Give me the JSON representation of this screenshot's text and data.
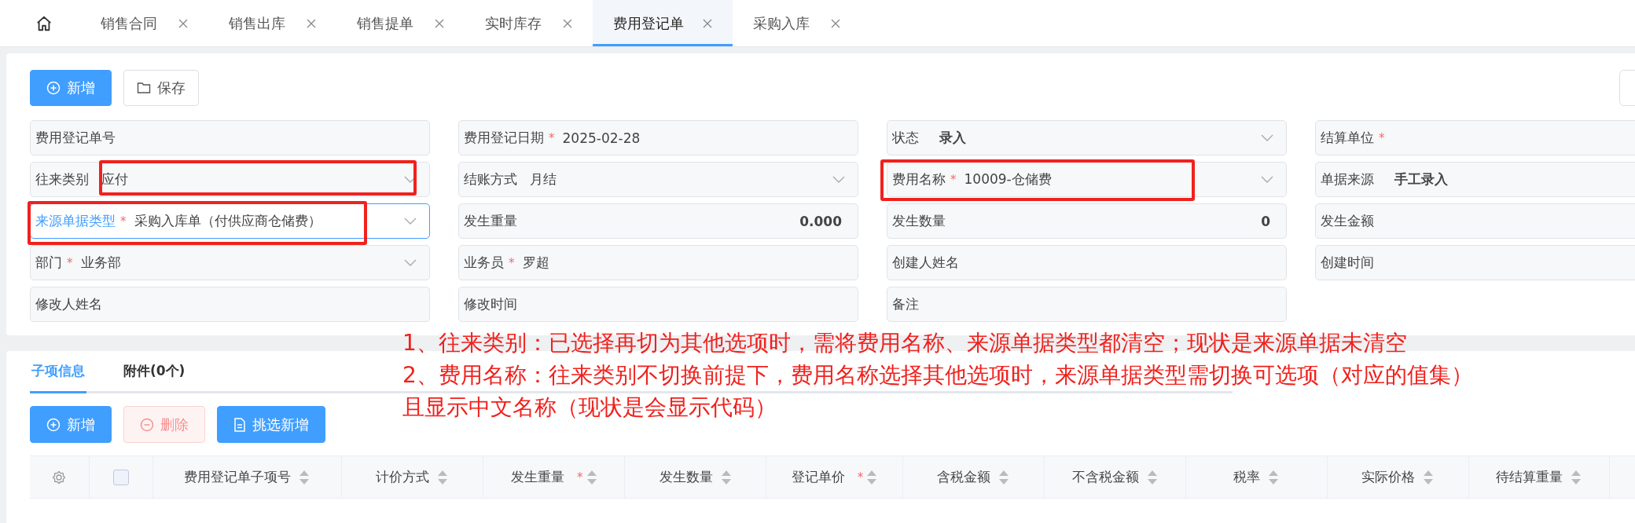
{
  "tabs": [
    {
      "label": "销售合同",
      "selected": false
    },
    {
      "label": "销售出库",
      "selected": false
    },
    {
      "label": "销售提单",
      "selected": false
    },
    {
      "label": "实时库存",
      "selected": false
    },
    {
      "label": "费用登记单",
      "selected": true
    },
    {
      "label": "采购入库",
      "selected": false
    }
  ],
  "toolbar": [
    {
      "label": "新增",
      "kind": "primary"
    },
    {
      "label": "保存",
      "kind": "default"
    }
  ],
  "fields": [
    {
      "label": "费用登记单号",
      "kind": "text",
      "focused": false,
      "highlighted": false
    },
    {
      "label": "费用登记日期",
      "required_mark": "*",
      "kind": "text",
      "value": "2025-02-28",
      "emphasis": false,
      "focused": false,
      "highlighted": false
    },
    {
      "label": "状态",
      "kind": "select",
      "value": "录入",
      "emphasis": true,
      "focused": false,
      "highlighted": false
    },
    {
      "label": "结算单位",
      "required_mark": "*",
      "kind": "text",
      "focused": false,
      "highlighted": false
    },
    {
      "label": "往来类别",
      "kind": "select",
      "value": "应付",
      "emphasis": false,
      "focused": false,
      "highlighted": true
    },
    {
      "label": "结账方式",
      "kind": "select",
      "value": "月结",
      "emphasis": false,
      "focused": false,
      "highlighted": false
    },
    {
      "label": "费用名称",
      "required_mark": "*",
      "kind": "select",
      "value": "10009-仓储费",
      "emphasis": false,
      "focused": false,
      "highlighted": true
    },
    {
      "label": "单据来源",
      "kind": "text",
      "value": "手工录入",
      "emphasis": true,
      "focused": false,
      "highlighted": false
    },
    {
      "label": "来源单据类型",
      "required_mark": "*",
      "kind": "select",
      "value": "采购入库单（付供应商仓储费）",
      "emphasis": false,
      "focused": true,
      "highlighted": true
    },
    {
      "label": "发生重量",
      "kind": "number",
      "value": "0.000",
      "emphasis": true,
      "focused": false,
      "highlighted": false
    },
    {
      "label": "发生数量",
      "kind": "number",
      "value": "0",
      "emphasis": true,
      "focused": false,
      "highlighted": false
    },
    {
      "label": "发生金额",
      "kind": "text",
      "focused": false,
      "highlighted": false
    },
    {
      "label": "部门",
      "required_mark": "*",
      "kind": "select",
      "value": "业务部",
      "emphasis": false,
      "focused": false,
      "highlighted": false
    },
    {
      "label": "业务员",
      "required_mark": "*",
      "kind": "text",
      "value": "罗超",
      "emphasis": false,
      "focused": false,
      "highlighted": false
    },
    {
      "label": "创建人姓名",
      "kind": "text",
      "focused": false,
      "highlighted": false
    },
    {
      "label": "创建时间",
      "kind": "text",
      "focused": false,
      "highlighted": false
    },
    {
      "label": "修改人姓名",
      "kind": "text",
      "focused": false,
      "highlighted": false
    },
    {
      "label": "修改时间",
      "kind": "text",
      "focused": false,
      "highlighted": false
    },
    {
      "label": "备注",
      "kind": "text",
      "focused": false,
      "highlighted": false
    }
  ],
  "annotations": [
    "1、往来类别：已选择再切为其他选项时，需将费用名称、来源单据类型都清空；现状是来源单据未清空",
    "2、费用名称：往来类别不切换前提下，费用名称选择其他选项时，来源单据类型需切换可选项（对应的值集）",
    "且显示中文名称（现状是会显示代码）"
  ],
  "subtabs": [
    {
      "label": "子项信息",
      "selected": true
    },
    {
      "label": "附件(0个)",
      "selected": false
    }
  ],
  "item_buttons": [
    {
      "label": "新增",
      "kind": "add",
      "disabled": false
    },
    {
      "label": "删除",
      "kind": "delete",
      "disabled": true
    },
    {
      "label": "挑选新增",
      "kind": "pick",
      "disabled": false
    }
  ],
  "table": {
    "select_all": {
      "checked": false
    },
    "columns": [
      {
        "label": "费用登记单子项号"
      },
      {
        "label": "计价方式"
      },
      {
        "label": "发生重量",
        "required_mark": "*"
      },
      {
        "label": "发生数量"
      },
      {
        "label": "登记单价",
        "required_mark": "*"
      },
      {
        "label": "含税金额"
      },
      {
        "label": "不含税金额"
      },
      {
        "label": "税率"
      },
      {
        "label": "实际价格"
      },
      {
        "label": "待结算重量"
      }
    ]
  }
}
